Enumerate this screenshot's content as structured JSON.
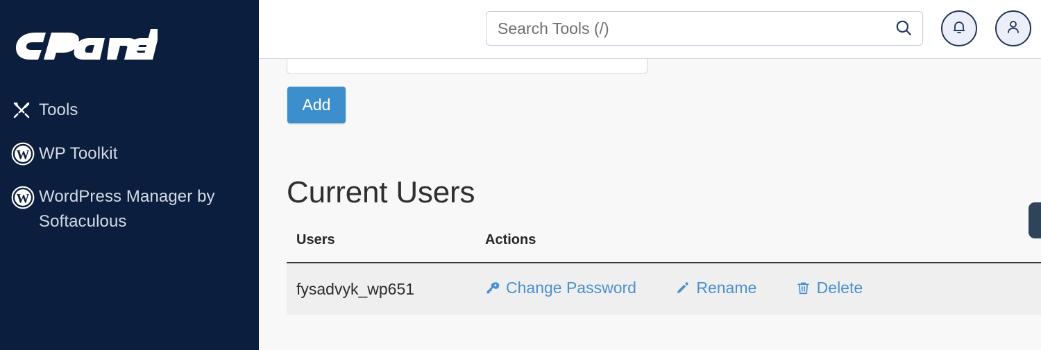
{
  "sidebar": {
    "brand": "cPanel",
    "items": [
      {
        "label": "Tools",
        "icon": "tools-icon"
      },
      {
        "label": "WP Toolkit",
        "icon": "wordpress-icon"
      },
      {
        "label": "WordPress Manager by Softaculous",
        "icon": "wordpress-icon"
      }
    ]
  },
  "header": {
    "search": {
      "placeholder": "Search Tools (/)",
      "value": "",
      "icon": "search-icon"
    },
    "notifications_icon": "bell-icon",
    "account_icon": "user-icon"
  },
  "main": {
    "new_user_input": {
      "value": "",
      "placeholder": ""
    },
    "add_label": "Add",
    "section_title": "Current Users",
    "table": {
      "columns": [
        "Users",
        "Actions"
      ],
      "rows": [
        {
          "user": "fysadvyk_wp651",
          "actions": [
            {
              "label": "Change Password",
              "icon": "key-icon"
            },
            {
              "label": "Rename",
              "icon": "pencil-icon"
            },
            {
              "label": "Delete",
              "icon": "trash-icon"
            }
          ]
        }
      ]
    }
  },
  "colors": {
    "sidebar_bg": "#0b1e3d",
    "accent_blue": "#3d8ecc",
    "link_blue": "#4a90cf",
    "row_bg": "#efefef",
    "page_bg": "#f8f8f8"
  }
}
